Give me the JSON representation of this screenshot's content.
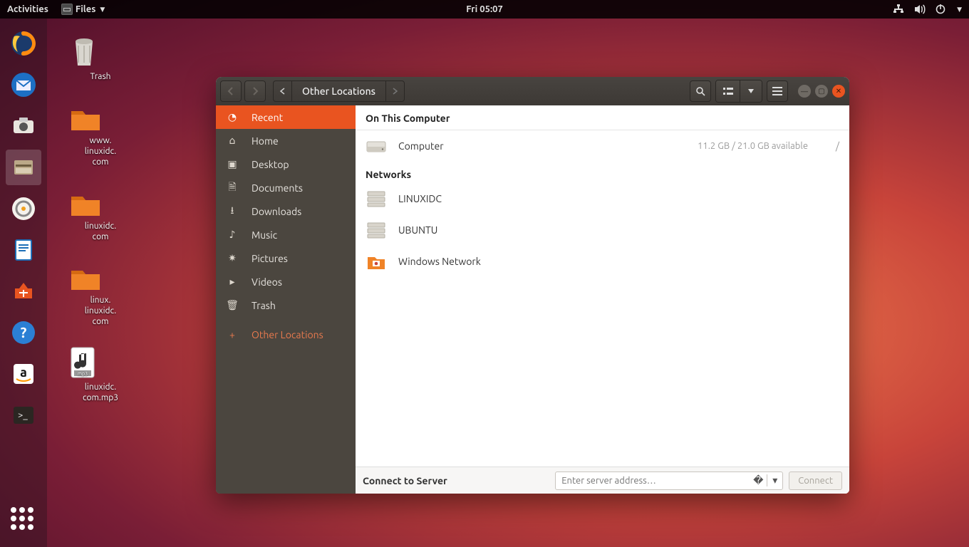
{
  "topbar": {
    "activities": "Activities",
    "app_menu": "Files",
    "clock": "Fri 05:07"
  },
  "desktop_icons": [
    {
      "id": "trash",
      "label": "Trash"
    },
    {
      "id": "www",
      "label": "www.\nlinuxidc.\ncom"
    },
    {
      "id": "lxc",
      "label": "linuxidc.\ncom"
    },
    {
      "id": "lnx",
      "label": "linux.\nlinuxidc.\ncom"
    },
    {
      "id": "mp3",
      "label": "linuxidc.\ncom.mp3"
    }
  ],
  "window": {
    "path_label": "Other Locations",
    "sidebar": [
      {
        "icon": "clock",
        "label": "Recent",
        "selected": true
      },
      {
        "icon": "home",
        "label": "Home"
      },
      {
        "icon": "desktop",
        "label": "Desktop"
      },
      {
        "icon": "doc",
        "label": "Documents"
      },
      {
        "icon": "download",
        "label": "Downloads"
      },
      {
        "icon": "music",
        "label": "Music"
      },
      {
        "icon": "camera",
        "label": "Pictures"
      },
      {
        "icon": "video",
        "label": "Videos"
      },
      {
        "icon": "trash",
        "label": "Trash"
      }
    ],
    "other_locations_label": "Other Locations",
    "sections": {
      "computer_heading": "On This Computer",
      "computer_row": {
        "name": "Computer",
        "disk": "11.2 GB / 21.0 GB available",
        "mount": "/"
      },
      "network_heading": "Networks",
      "networks": [
        {
          "name": "LINUXIDC",
          "icon": "server"
        },
        {
          "name": "UBUNTU",
          "icon": "server"
        },
        {
          "name": "Windows Network",
          "icon": "folder"
        }
      ]
    },
    "footer": {
      "label": "Connect to Server",
      "placeholder": "Enter server address…",
      "connect": "Connect"
    }
  }
}
